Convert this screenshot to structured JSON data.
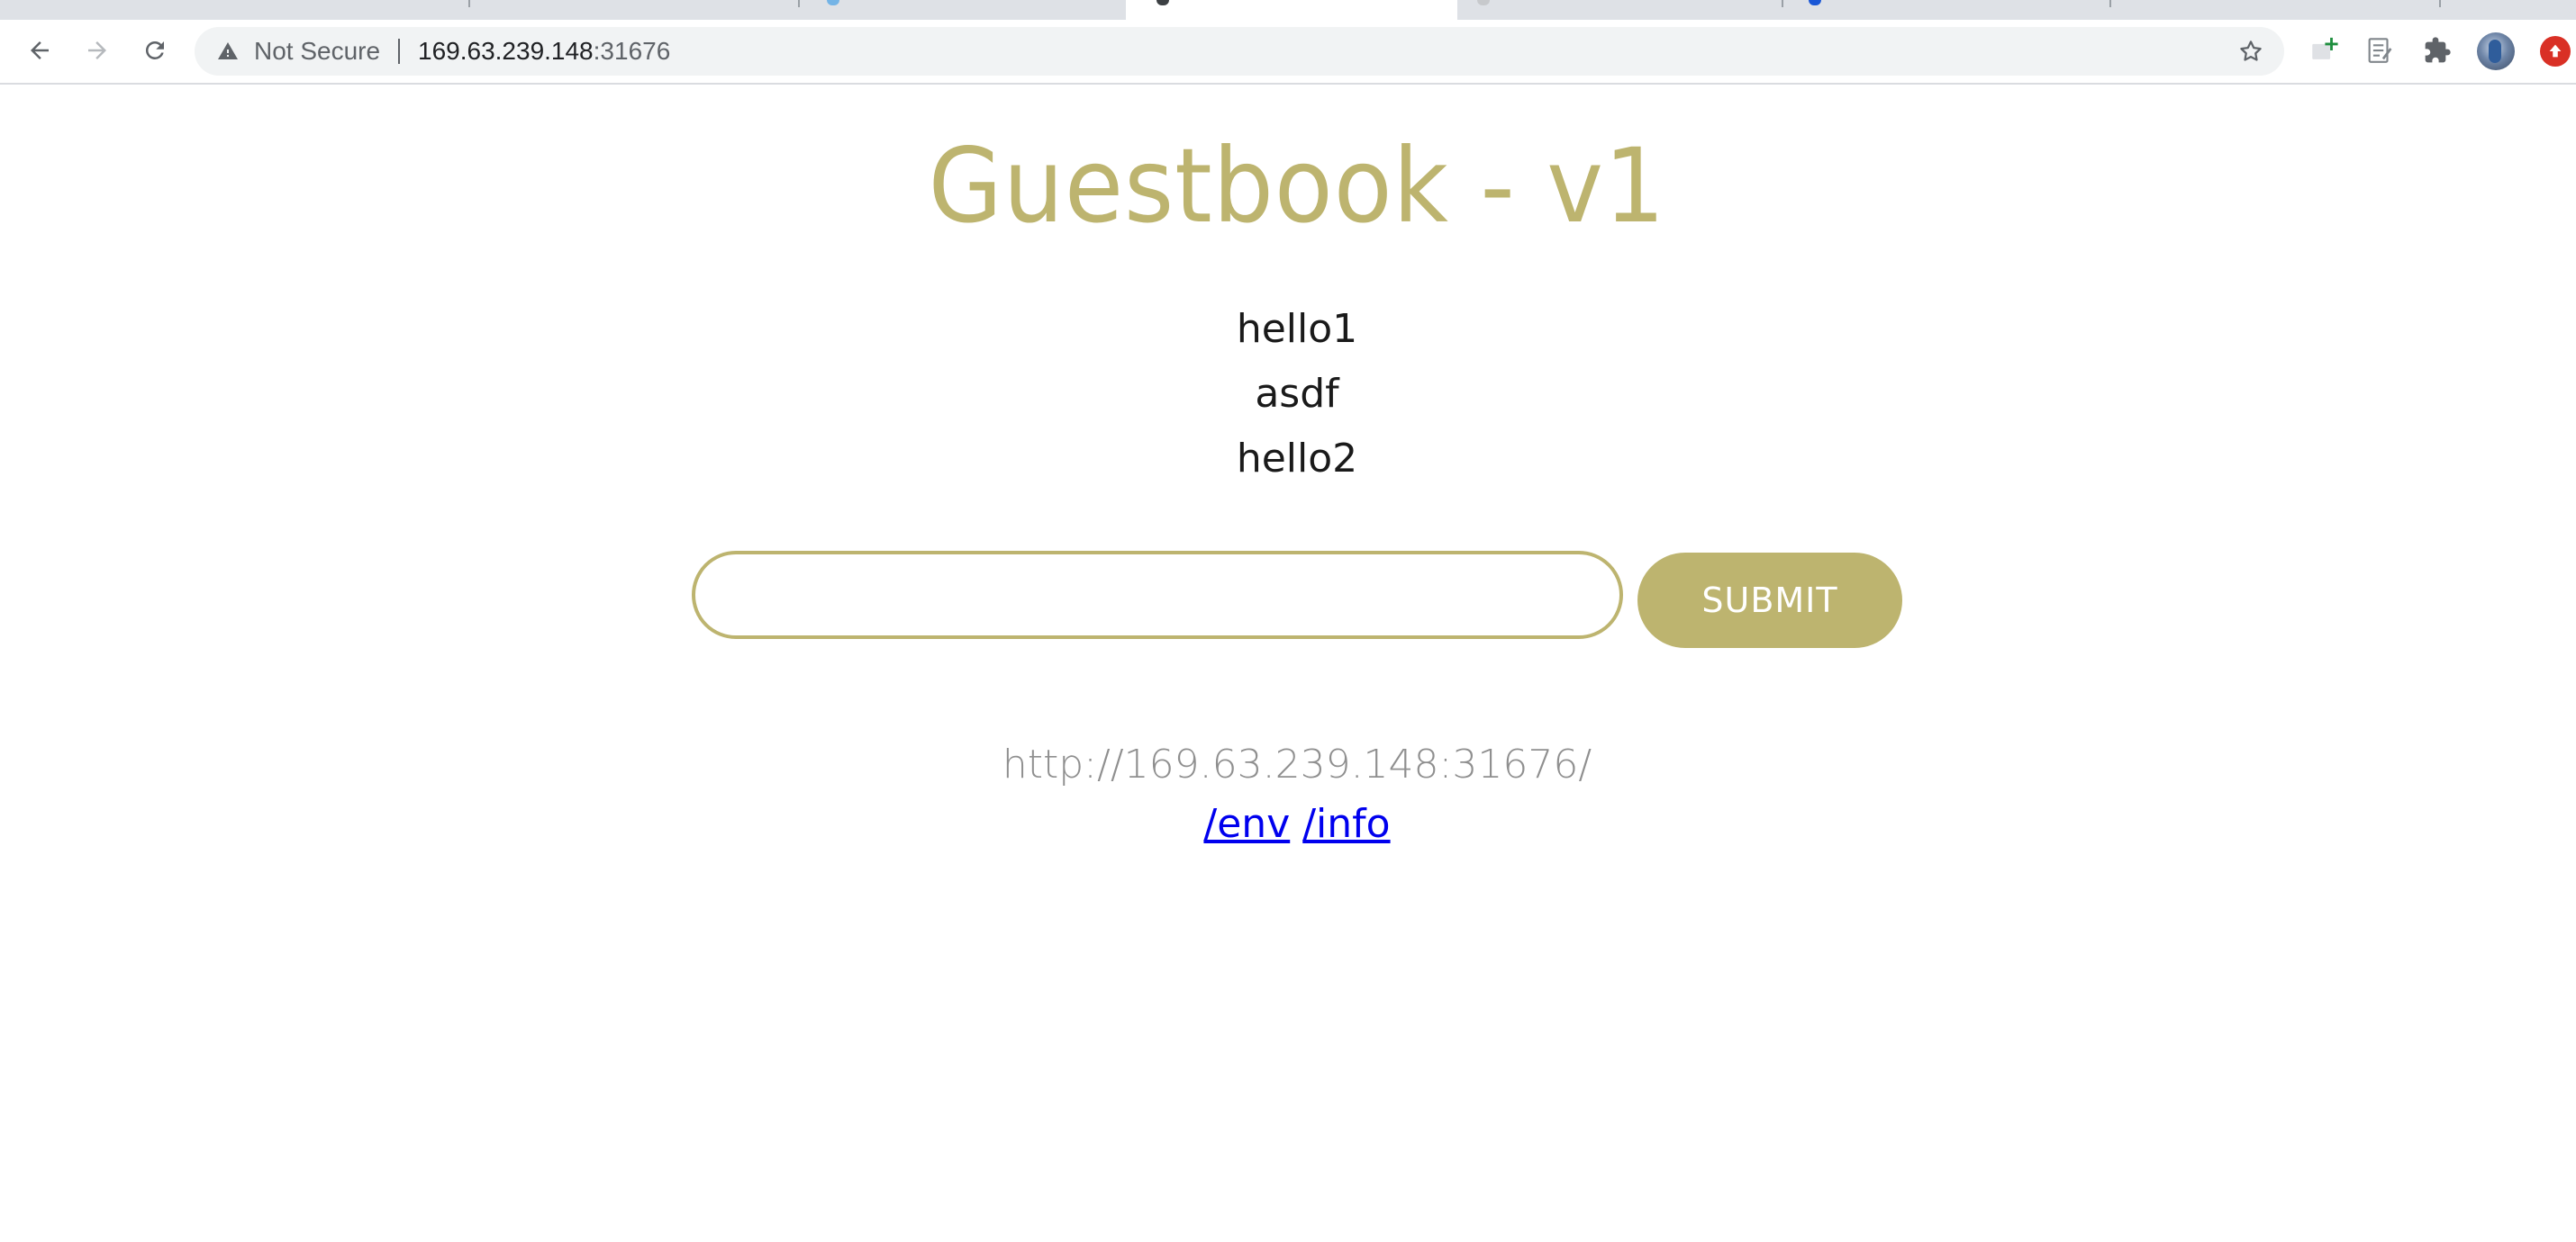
{
  "browser": {
    "security_label": "Not Secure",
    "url_host": "169.63.239.148",
    "url_port": ":31676",
    "icons": {
      "back": "back-arrow-icon",
      "forward": "forward-arrow-icon",
      "reload": "reload-icon",
      "warning": "warning-triangle-icon",
      "bookmark": "star-icon",
      "extensions": "puzzle-icon",
      "update": "update-arrow-icon"
    }
  },
  "page": {
    "title": "Guestbook - v1",
    "entries": [
      "hello1",
      "asdf",
      "hello2"
    ],
    "input_value": "",
    "submit_label": "SUBMIT",
    "host_url": "http://169.63.239.148:31676/",
    "links": [
      {
        "label": "/env"
      },
      {
        "label": "/info"
      }
    ]
  },
  "colors": {
    "accent": "#bdb46f",
    "link": "#0000ee",
    "muted_text": "#8f8f8f"
  }
}
